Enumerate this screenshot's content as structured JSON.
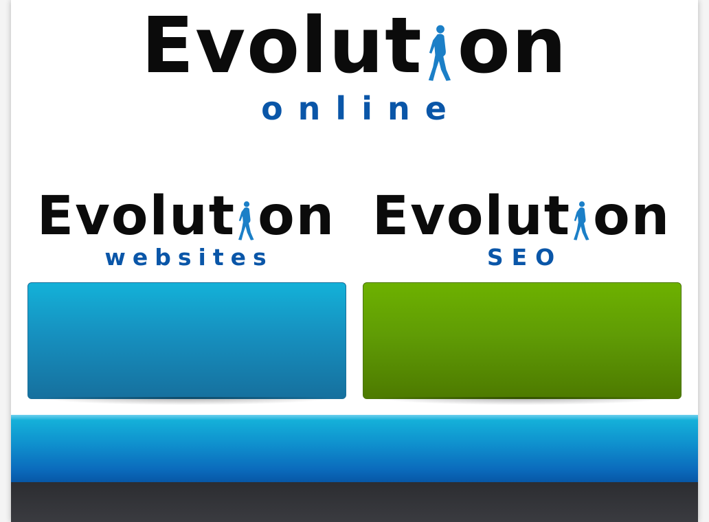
{
  "header_logo": {
    "letters_before": "Evolut",
    "letters_after": "on",
    "tagline": "online",
    "figure_icon": "walking-man-icon"
  },
  "logo_websites": {
    "letters_before": "Evolut",
    "letters_after": "on",
    "tagline": "websites",
    "figure_icon": "walking-man-icon"
  },
  "logo_seo": {
    "letters_before": "Evolut",
    "letters_after": "on",
    "tagline": "SEO",
    "figure_icon": "walking-man-icon"
  },
  "colors": {
    "wordmark": "#0b0b0b",
    "tagline_blue": "#0a56a8",
    "figure_blue": "#1b7fc7",
    "panel_blue": "#1690bf",
    "panel_green": "#609c05",
    "band_blue": "#0f8fcd",
    "footer_dark": "#333438"
  }
}
